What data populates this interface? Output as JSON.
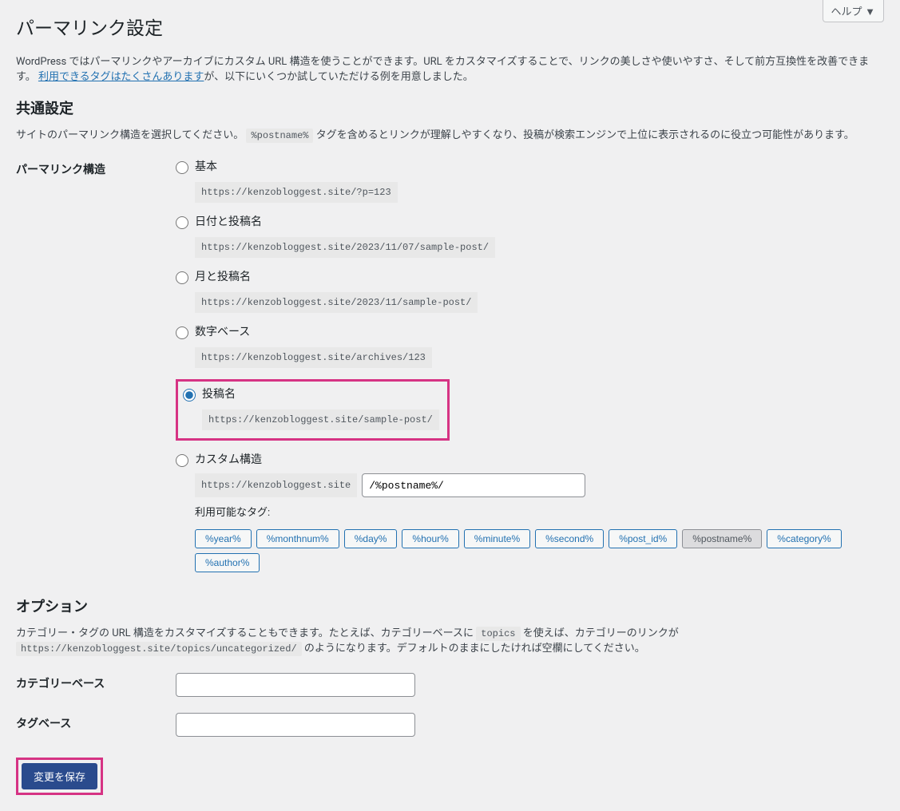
{
  "help_label": "ヘルプ ▼",
  "page_title": "パーマリンク設定",
  "intro": {
    "text1": "WordPress ではパーマリンクやアーカイブにカスタム URL 構造を使うことができます。URL をカスタマイズすることで、リンクの美しさや使いやすさ、そして前方互換性を改善できます。",
    "link_text": "利用できるタグはたくさんあります",
    "text2": "が、以下にいくつか試していただける例を用意しました。"
  },
  "section_common": "共通設定",
  "common_desc": {
    "pre": "サイトのパーマリンク構造を選択してください。",
    "code": "%postname%",
    "post": "タグを含めるとリンクが理解しやすくなり、投稿が検索エンジンで上位に表示されるのに役立つ可能性があります。"
  },
  "structure_label": "パーマリンク構造",
  "options": {
    "basic": {
      "label": "基本",
      "url": "https://kenzobloggest.site/?p=123"
    },
    "date_name": {
      "label": "日付と投稿名",
      "url": "https://kenzobloggest.site/2023/11/07/sample-post/"
    },
    "month_name": {
      "label": "月と投稿名",
      "url": "https://kenzobloggest.site/2023/11/sample-post/"
    },
    "numeric": {
      "label": "数字ベース",
      "url": "https://kenzobloggest.site/archives/123"
    },
    "postname": {
      "label": "投稿名",
      "url": "https://kenzobloggest.site/sample-post/"
    },
    "custom": {
      "label": "カスタム構造",
      "prefix": "https://kenzobloggest.site",
      "value": "/%postname%/"
    }
  },
  "available_tags_label": "利用可能なタグ:",
  "tags": [
    "%year%",
    "%monthnum%",
    "%day%",
    "%hour%",
    "%minute%",
    "%second%",
    "%post_id%",
    "%postname%",
    "%category%",
    "%author%"
  ],
  "active_tag": "%postname%",
  "section_option": "オプション",
  "option_desc": {
    "pre": "カテゴリー・タグの URL 構造をカスタマイズすることもできます。たとえば、カテゴリーベースに",
    "code1": "topics",
    "mid": "を使えば、カテゴリーのリンクが",
    "code2": "https://kenzobloggest.site/topics/uncategorized/",
    "post": "のようになります。デフォルトのままにしたければ空欄にしてください。"
  },
  "category_base_label": "カテゴリーベース",
  "tag_base_label": "タグベース",
  "submit_label": "変更を保存"
}
